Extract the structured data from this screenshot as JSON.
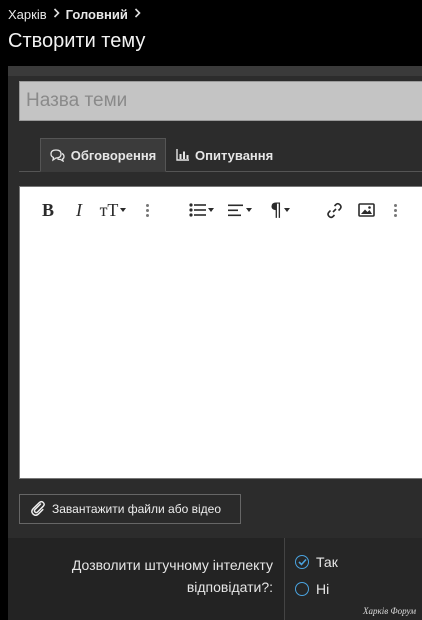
{
  "breadcrumb": {
    "items": [
      "Харків",
      "Головний"
    ]
  },
  "page": {
    "title": "Створити тему"
  },
  "form": {
    "title_placeholder": "Назва теми",
    "tabs": [
      {
        "label": "Обговорення",
        "icon": "chat-bubbles-icon",
        "active": true
      },
      {
        "label": "Опитування",
        "icon": "bar-chart-icon",
        "active": false
      }
    ],
    "toolbar": {
      "bold": "B",
      "italic": "I",
      "text_size": "тТ",
      "tools": [
        "bold-icon",
        "italic-icon",
        "text-size-icon",
        "more-icon",
        "list-icon",
        "align-icon",
        "paragraph-icon",
        "link-icon",
        "image-icon",
        "more-icon"
      ]
    },
    "upload_label": "Завантажити файли або відео",
    "ai_question": "Дозволити штучному інтелекту відповідати?:",
    "ai_options": [
      {
        "label": "Так",
        "checked": true
      },
      {
        "label": "Ні",
        "checked": false
      }
    ]
  },
  "watermark": "Харків Форум",
  "colors": {
    "accent": "#4aa3df",
    "panel": "#2c2c2c",
    "input_bg": "#c4c4c4"
  }
}
